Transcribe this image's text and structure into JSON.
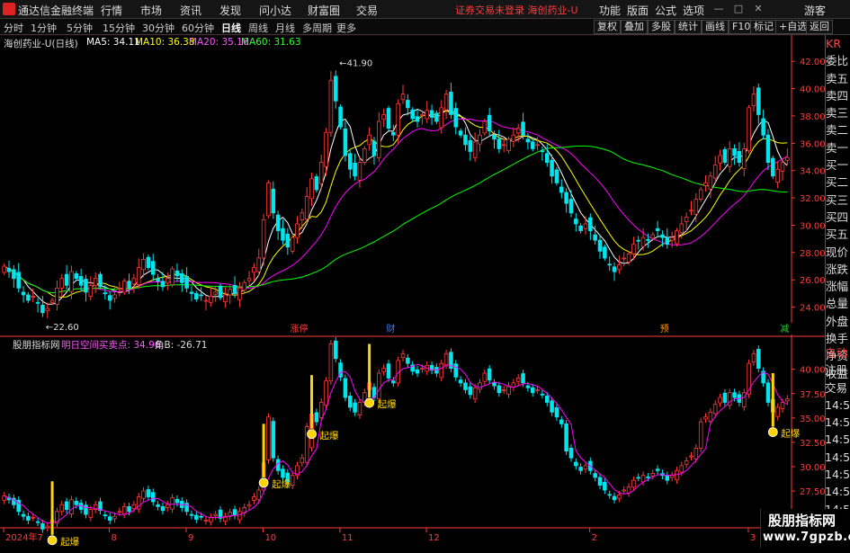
{
  "app": {
    "title": "通达信金融终端"
  },
  "menu": [
    "行情",
    "市场",
    "资讯",
    "发现",
    "问小达",
    "财富圈",
    "交易"
  ],
  "notice": "证券交易未登录  海创药业-U",
  "right_menu": [
    "功能",
    "版面",
    "公式",
    "选项",
    "游客"
  ],
  "window_controls": [
    "—",
    "□",
    "✕"
  ],
  "periods": [
    "分时",
    "1分钟",
    "5分钟",
    "15分钟",
    "30分钟",
    "60分钟",
    "日线",
    "周线",
    "月线",
    "多周期",
    "更多"
  ],
  "active_period": "日线",
  "right_buttons": [
    "复权",
    "叠加",
    "多股",
    "统计",
    "画线",
    "F10",
    "标记",
    "+自选",
    "返回"
  ],
  "price_info": {
    "name": "海创药业-U(日线)",
    "ma5": "MA5: 34.11",
    "ma10": "MA10: 36.38",
    "ma20": "MA20: 35.16",
    "ma60": "MA60: 31.63"
  },
  "indicator_info": {
    "name": "股朋指标网",
    "line1": "明日空间买卖点: 34.96",
    "line2": "角B: -26.71"
  },
  "colors": {
    "up": "#ff3b3b",
    "down": "#00e5ee",
    "ma5": "#ffffff",
    "ma10": "#ffff00",
    "ma20": "#ff00ff",
    "ma60": "#00ff00",
    "grid": "#7a0000",
    "axis": "#ff3b3b"
  },
  "chart_data": [
    {
      "type": "candlestick",
      "title": "海创药业-U(日线)",
      "ylim": [
        22,
        43
      ],
      "y_ticks": [
        24,
        26,
        28,
        30,
        32,
        34,
        36,
        38,
        40,
        42
      ],
      "y_tick_labels": [
        "24.00",
        "26.00",
        "28.00",
        "30.00",
        "32.00",
        "34.00",
        "36.00",
        "38.00",
        "40.00",
        "42.00"
      ],
      "annotations": {
        "high": "41.90",
        "low": "22.60"
      },
      "event_markers": [
        "涨停",
        "财",
        "预",
        "减"
      ],
      "close": [
        27.0,
        26.6,
        26.1,
        25.4,
        24.9,
        24.5,
        24.8,
        24.3,
        23.6,
        23.9,
        24.5,
        25.4,
        26.1,
        25.6,
        26.6,
        26.1,
        25.6,
        25.1,
        25.6,
        26.1,
        25.5,
        25.0,
        24.5,
        24.9,
        25.4,
        25.9,
        25.4,
        26.1,
        26.9,
        27.5,
        26.9,
        26.4,
        25.9,
        25.5,
        26.1,
        26.8,
        26.3,
        25.8,
        25.4,
        25.0,
        24.6,
        24.9,
        24.5,
        24.8,
        25.1,
        24.7,
        24.9,
        25.3,
        25.0,
        25.4,
        25.8,
        26.1,
        26.9,
        27.6,
        30.4,
        33.1,
        30.9,
        29.6,
        28.9,
        28.4,
        29.1,
        30.1,
        30.9,
        32.1,
        33.4,
        32.6,
        34.6,
        36.8,
        40.6,
        39.1,
        37.2,
        35.1,
        34.1,
        33.6,
        34.6,
        35.6,
        36.6,
        35.1,
        37.6,
        38.1,
        37.1,
        36.6,
        38.9,
        39.6,
        38.6,
        37.8,
        37.6,
        38.1,
        38.4,
        37.9,
        37.6,
        38.6,
        39.6,
        38.1,
        37.2,
        36.6,
        35.9,
        35.4,
        36.1,
        36.6,
        37.6,
        36.9,
        36.3,
        35.6,
        35.9,
        36.3,
        36.6,
        37.1,
        36.6,
        36.1,
        35.6,
        35.9,
        35.4,
        34.6,
        33.6,
        33.1,
        32.4,
        31.6,
        30.9,
        30.1,
        29.6,
        30.1,
        29.6,
        28.9,
        28.1,
        27.6,
        27.1,
        26.6,
        27.1,
        27.6,
        27.9,
        28.6,
        28.9,
        29.1,
        28.9,
        29.3,
        29.6,
        29.1,
        28.6,
        29.1,
        29.6,
        30.1,
        30.6,
        31.1,
        31.9,
        32.6,
        33.1,
        33.6,
        34.4,
        35.1,
        34.6,
        35.6,
        35.1,
        34.6,
        35.6,
        38.6,
        39.6,
        38.1,
        36.6,
        34.6,
        33.6,
        34.1,
        34.6,
        34.96
      ],
      "series": [
        {
          "name": "MA5",
          "value": 34.11
        },
        {
          "name": "MA10",
          "value": 36.38
        },
        {
          "name": "MA20",
          "value": 35.16
        },
        {
          "name": "MA60",
          "value": 31.63
        }
      ]
    },
    {
      "type": "indicator",
      "title": "股朋指标网",
      "ylim": [
        24,
        42
      ],
      "y_ticks": [
        25,
        27.5,
        30,
        32.5,
        35,
        37.5,
        40
      ],
      "y_tick_labels": [
        "25.00",
        "27.50",
        "30.00",
        "32.50",
        "35.00",
        "37.50",
        "40.00"
      ],
      "x_labels": [
        "2024年7",
        "8",
        "9",
        "10",
        "11",
        "12",
        "2",
        "3"
      ],
      "signal_label": "起爆",
      "signals": [
        {
          "index": 10
        },
        {
          "index": 54
        },
        {
          "index": 64
        },
        {
          "index": 76
        },
        {
          "index": 160
        }
      ]
    }
  ],
  "side_labels": [
    "委比",
    "卖五",
    "卖四",
    "卖三",
    "卖二",
    "卖一",
    "买一",
    "买二",
    "买三",
    "买四",
    "买五",
    "现价",
    "涨跌",
    "涨幅",
    "总量",
    "外盘",
    "换手",
    "净资",
    "收益"
  ],
  "side_labels2": [
    "自动",
    "注册",
    "交易",
    "14:55",
    "14:55",
    "14:55",
    "14:55",
    "14:56",
    "14:56",
    "14:56",
    "14:56",
    "14:56"
  ],
  "side_header": "KR",
  "watermark": {
    "title": "股朋指标网",
    "url": "www.7gpzb.com"
  }
}
